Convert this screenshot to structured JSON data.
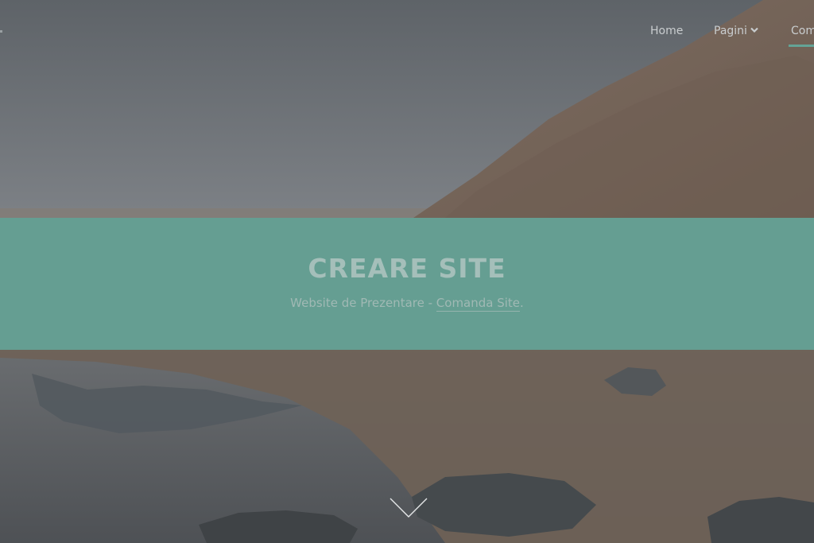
{
  "nav": {
    "items": [
      {
        "label": "Home"
      },
      {
        "label": "Pagini"
      },
      {
        "label": "Com"
      }
    ]
  },
  "hero": {
    "title": "CREARE SITE",
    "subtitle_prefix": "Website de Prezentare - ",
    "subtitle_link": "Comanda Site",
    "subtitle_suffix": "."
  },
  "colors": {
    "banner": "#659e92",
    "accent": "#64a396",
    "overlay": "#5e6268"
  },
  "icons": {
    "dropdown": "chevron-down-icon",
    "scroll": "chevron-down-icon"
  }
}
